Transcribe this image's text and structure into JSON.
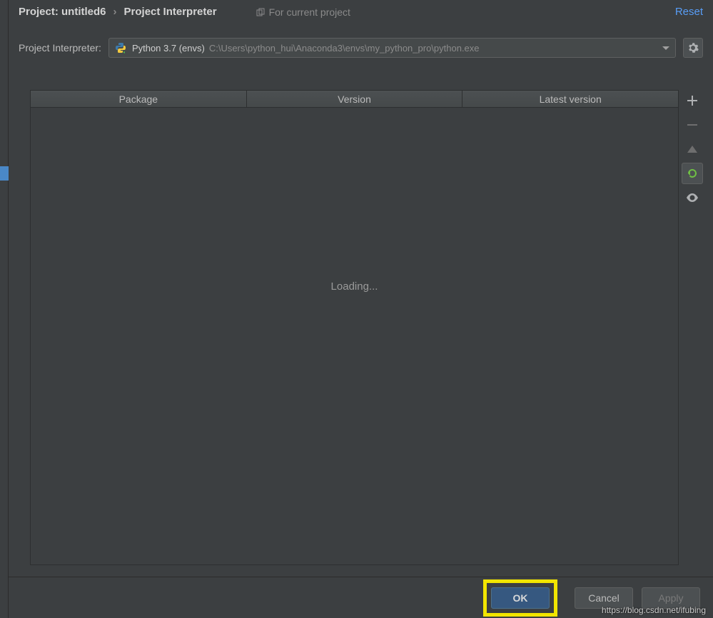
{
  "breadcrumb": {
    "project": "Project: untitled6",
    "section": "Project Interpreter",
    "scope_label": "For current project",
    "reset_label": "Reset"
  },
  "interpreter": {
    "label": "Project Interpreter:",
    "name": "Python 3.7 (envs)",
    "path": "C:\\Users\\python_hui\\Anaconda3\\envs\\my_python_pro\\python.exe"
  },
  "table": {
    "columns": [
      "Package",
      "Version",
      "Latest version"
    ],
    "loading_text": "Loading..."
  },
  "buttons": {
    "ok": "OK",
    "cancel": "Cancel",
    "apply": "Apply"
  },
  "watermark": "https://blog.csdn.net/ifubing"
}
